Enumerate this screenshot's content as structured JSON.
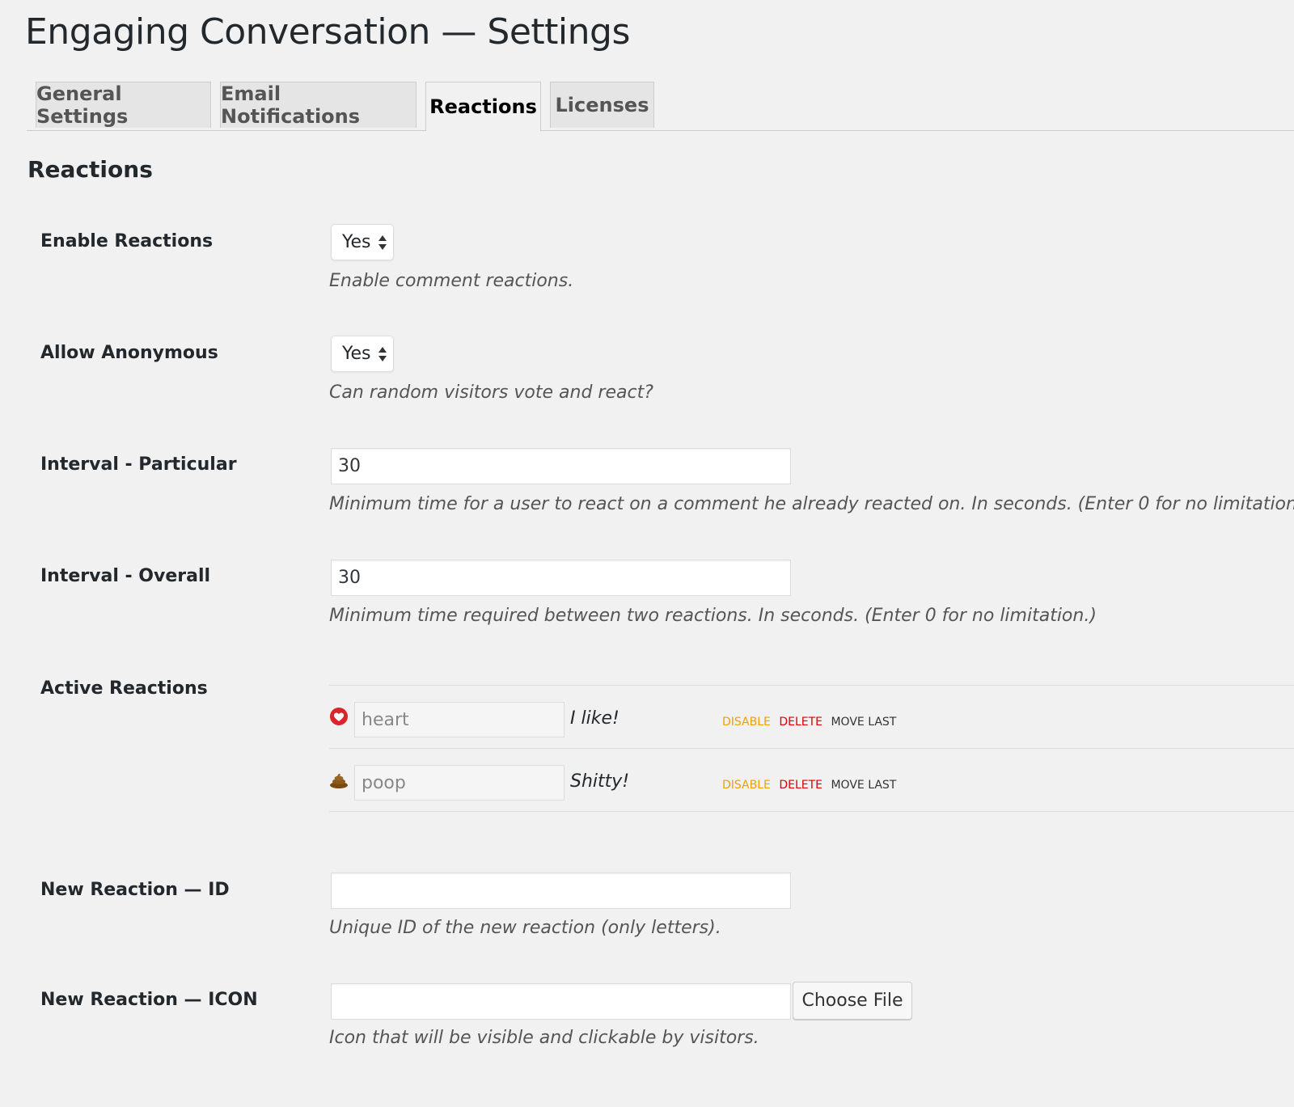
{
  "page": {
    "title": "Engaging Conversation — Settings"
  },
  "tabs": [
    {
      "label": "General Settings"
    },
    {
      "label": "Email Notifications"
    },
    {
      "label": "Reactions",
      "active": true
    },
    {
      "label": "Licenses"
    }
  ],
  "section": {
    "title": "Reactions"
  },
  "settings": {
    "enable_reactions": {
      "label": "Enable Reactions",
      "value": "Yes",
      "description": "Enable comment reactions."
    },
    "allow_anonymous": {
      "label": "Allow Anonymous",
      "value": "Yes",
      "description": "Can random visitors vote and react?"
    },
    "interval_particular": {
      "label": "Interval - Particular",
      "value": "30",
      "description": "Minimum time for a user to react on a comment he already reacted on. In seconds. (Enter 0 for no limitation.)"
    },
    "interval_overall": {
      "label": "Interval - Overall",
      "value": "30",
      "description": "Minimum time required between two reactions. In seconds. (Enter 0 for no limitation.)"
    },
    "active_reactions": {
      "label": "Active Reactions"
    },
    "new_reaction_id": {
      "label": "New Reaction — ID",
      "value": "",
      "description": "Unique ID of the new reaction (only letters)."
    },
    "new_reaction_icon": {
      "label": "New Reaction — ICON",
      "value": "",
      "button": "Choose File",
      "description": "Icon that will be visible and clickable by visitors."
    }
  },
  "reactions": [
    {
      "id": "heart",
      "label": "I like!",
      "icon": "heart-icon",
      "actions": {
        "disable": "DISABLE",
        "delete": "DELETE",
        "move": "MOVE LAST"
      }
    },
    {
      "id": "poop",
      "label": "Shitty!",
      "icon": "poop-icon",
      "actions": {
        "disable": "DISABLE",
        "delete": "DELETE",
        "move": "MOVE LAST"
      }
    }
  ],
  "colors": {
    "disable": "#f0a000",
    "delete": "#dd0000",
    "heart": "#d9252b",
    "poop": "#8b5a1a"
  }
}
